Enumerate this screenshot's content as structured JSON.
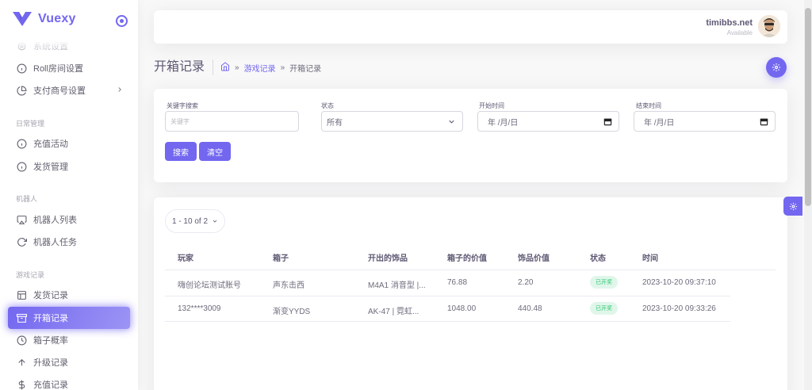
{
  "brand": {
    "name": "Vuexy",
    "color": "#7367f0"
  },
  "sidebar": {
    "partial_item": "系统设置",
    "items_top": [
      {
        "label": "Roll房间设置",
        "icon": "info-icon"
      },
      {
        "label": "支付商号设置",
        "icon": "pie-chart-icon",
        "has_submenu": true
      }
    ],
    "section_daily": "日常管理",
    "items_daily": [
      {
        "label": "充值活动",
        "icon": "info-icon"
      },
      {
        "label": "发货管理",
        "icon": "info-icon"
      }
    ],
    "section_robot": "机器人",
    "items_robot": [
      {
        "label": "机器人列表",
        "icon": "airplay-icon"
      },
      {
        "label": "机器人任务",
        "icon": "rotate-cw-icon"
      }
    ],
    "section_game": "游戏记录",
    "items_game": [
      {
        "label": "发货记录",
        "icon": "layout-icon"
      },
      {
        "label": "开箱记录",
        "icon": "archive-icon",
        "active": true
      },
      {
        "label": "箱子概率",
        "icon": "clock-icon"
      },
      {
        "label": "升级记录",
        "icon": "arrow-up-icon"
      },
      {
        "label": "充值记录",
        "icon": "dollar-icon"
      }
    ]
  },
  "navbar": {
    "user_name": "timibbs.net",
    "user_status": "Available"
  },
  "page": {
    "title": "开箱记录",
    "breadcrumb": {
      "sep1": "»",
      "link": "游戏记录",
      "sep2": "»",
      "current": "开箱记录"
    }
  },
  "filters": {
    "keyword": {
      "label": "关键字搜索",
      "placeholder": "关键字"
    },
    "status": {
      "label": "状态",
      "value": "所有"
    },
    "start_date": {
      "label": "开始时间",
      "value": "年 /月/日"
    },
    "end_date": {
      "label": "结束时间",
      "value": "年 /月/日"
    },
    "search_button": "搜索",
    "clear_button": "清空"
  },
  "table": {
    "pager": "1 - 10 of 2",
    "headers": [
      "玩家",
      "箱子",
      "开出的饰品",
      "箱子的价值",
      "饰品价值",
      "状态",
      "时间"
    ],
    "rows": [
      {
        "player": "嗨创论坛测试账号",
        "box": "声东击西",
        "item": "M4A1 消音型 |...",
        "box_value": "76.88",
        "item_value": "2.20",
        "status": "已开奖",
        "time": "2023-10-20 09:37:10"
      },
      {
        "player": "132****3009",
        "box": "渐变YYDS",
        "item": "AK-47 | 霓虹...",
        "box_value": "1048.00",
        "item_value": "440.48",
        "status": "已开奖",
        "time": "2023-10-20 09:33:26"
      }
    ]
  }
}
